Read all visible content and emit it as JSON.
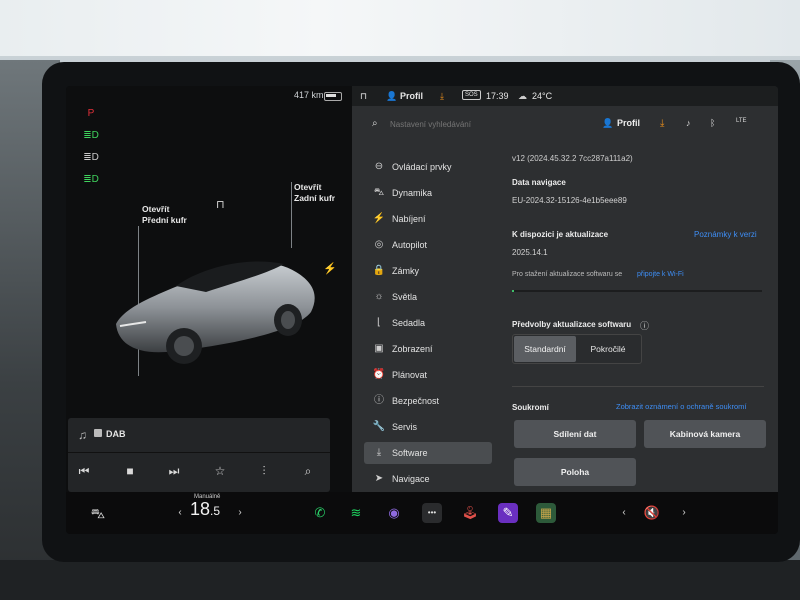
{
  "left_pane": {
    "range": "417 km",
    "telltales": [
      {
        "name": "park-brake-icon",
        "glyph": "P",
        "color": "#e2303a"
      },
      {
        "name": "low-beam-icon",
        "glyph": "≣D",
        "color": "#3fd35d"
      },
      {
        "name": "high-beam-icon",
        "glyph": "≣D",
        "color": "#c9c9c9"
      },
      {
        "name": "fog-light-icon",
        "glyph": "≣D",
        "color": "#3fd35d"
      }
    ],
    "frunk_label": [
      "Otevřít",
      "Přední kufr"
    ],
    "trunk_label": [
      "Otevřít",
      "Zadní kufr"
    ],
    "music": {
      "source": "DAB"
    }
  },
  "bottom_bar": {
    "temp_mode": "Manuálně",
    "temp_whole": "18",
    "temp_frac": ".5",
    "app_icons": [
      {
        "name": "phone-icon",
        "glyph": "✆",
        "color": "#2bd46a"
      },
      {
        "name": "spotify-icon",
        "glyph": "≋",
        "color": "#1ed760"
      },
      {
        "name": "camera-icon",
        "glyph": "◉",
        "color": "#8e6ae0"
      },
      {
        "name": "more-apps-icon",
        "glyph": "•••",
        "color": "#e0e0e0"
      },
      {
        "name": "joystick-icon",
        "glyph": "🕹",
        "color": "#e0504a"
      },
      {
        "name": "toybox-icon",
        "glyph": "✎",
        "color": "#b05ce8"
      },
      {
        "name": "arcade-icon",
        "glyph": "▦",
        "color": "#c7a54a"
      }
    ]
  },
  "status_bar": {
    "profile": "Profil",
    "sos": "SOS",
    "time": "17:39",
    "temperature": "24°C"
  },
  "search": {
    "placeholder": "Nastavení vyhledávání",
    "profile": "Profil",
    "signal": "LTE"
  },
  "menu": [
    {
      "label": "Ovládací prvky",
      "icon": "toggle-icon",
      "glyph": "⊖"
    },
    {
      "label": "Dynamika",
      "icon": "car-icon",
      "glyph": "⛍"
    },
    {
      "label": "Nabíjení",
      "icon": "bolt-icon",
      "glyph": "⚡"
    },
    {
      "label": "Autopilot",
      "icon": "steering-wheel-icon",
      "glyph": "◎"
    },
    {
      "label": "Zámky",
      "icon": "lock-icon",
      "glyph": "🔒"
    },
    {
      "label": "Světla",
      "icon": "sun-icon",
      "glyph": "☼"
    },
    {
      "label": "Sedadla",
      "icon": "seat-icon",
      "glyph": "⌊"
    },
    {
      "label": "Zobrazení",
      "icon": "display-icon",
      "glyph": "▣"
    },
    {
      "label": "Plánovat",
      "icon": "clock-icon",
      "glyph": "⏰"
    },
    {
      "label": "Bezpečnost",
      "icon": "shield-icon",
      "glyph": "ⓘ"
    },
    {
      "label": "Servis",
      "icon": "wrench-icon",
      "glyph": "🔧"
    },
    {
      "label": "Software",
      "icon": "download-icon",
      "glyph": "⤓",
      "active": true
    },
    {
      "label": "Navigace",
      "icon": "navigation-icon",
      "glyph": "➤"
    }
  ],
  "software": {
    "version": "v12 (2024.45.32.2 7cc287a111a2)",
    "nav_data_title": "Data navigace",
    "nav_data_value": "EU-2024.32-15126-4e1b5eee89",
    "update_title": "K dispozici je aktualizace",
    "release_notes": "Poznámky k verzi",
    "update_version": "2025.14.1",
    "download_text": "Pro stažení aktualizace softwaru se",
    "download_link": "připojte k Wi-Fi",
    "prefs_title": "Předvolby aktualizace softwaru",
    "pref_options": [
      "Standardní",
      "Pokročilé"
    ],
    "privacy_title": "Soukromí",
    "privacy_link": "Zobrazit oznámení o ochraně soukromí",
    "privacy_buttons": [
      "Sdílení dat",
      "Kabinová kamera",
      "Poloha"
    ]
  },
  "colors": {
    "accent_blue": "#3e8ef5",
    "warning_red": "#e2303a",
    "orange_download": "#f0921c"
  }
}
